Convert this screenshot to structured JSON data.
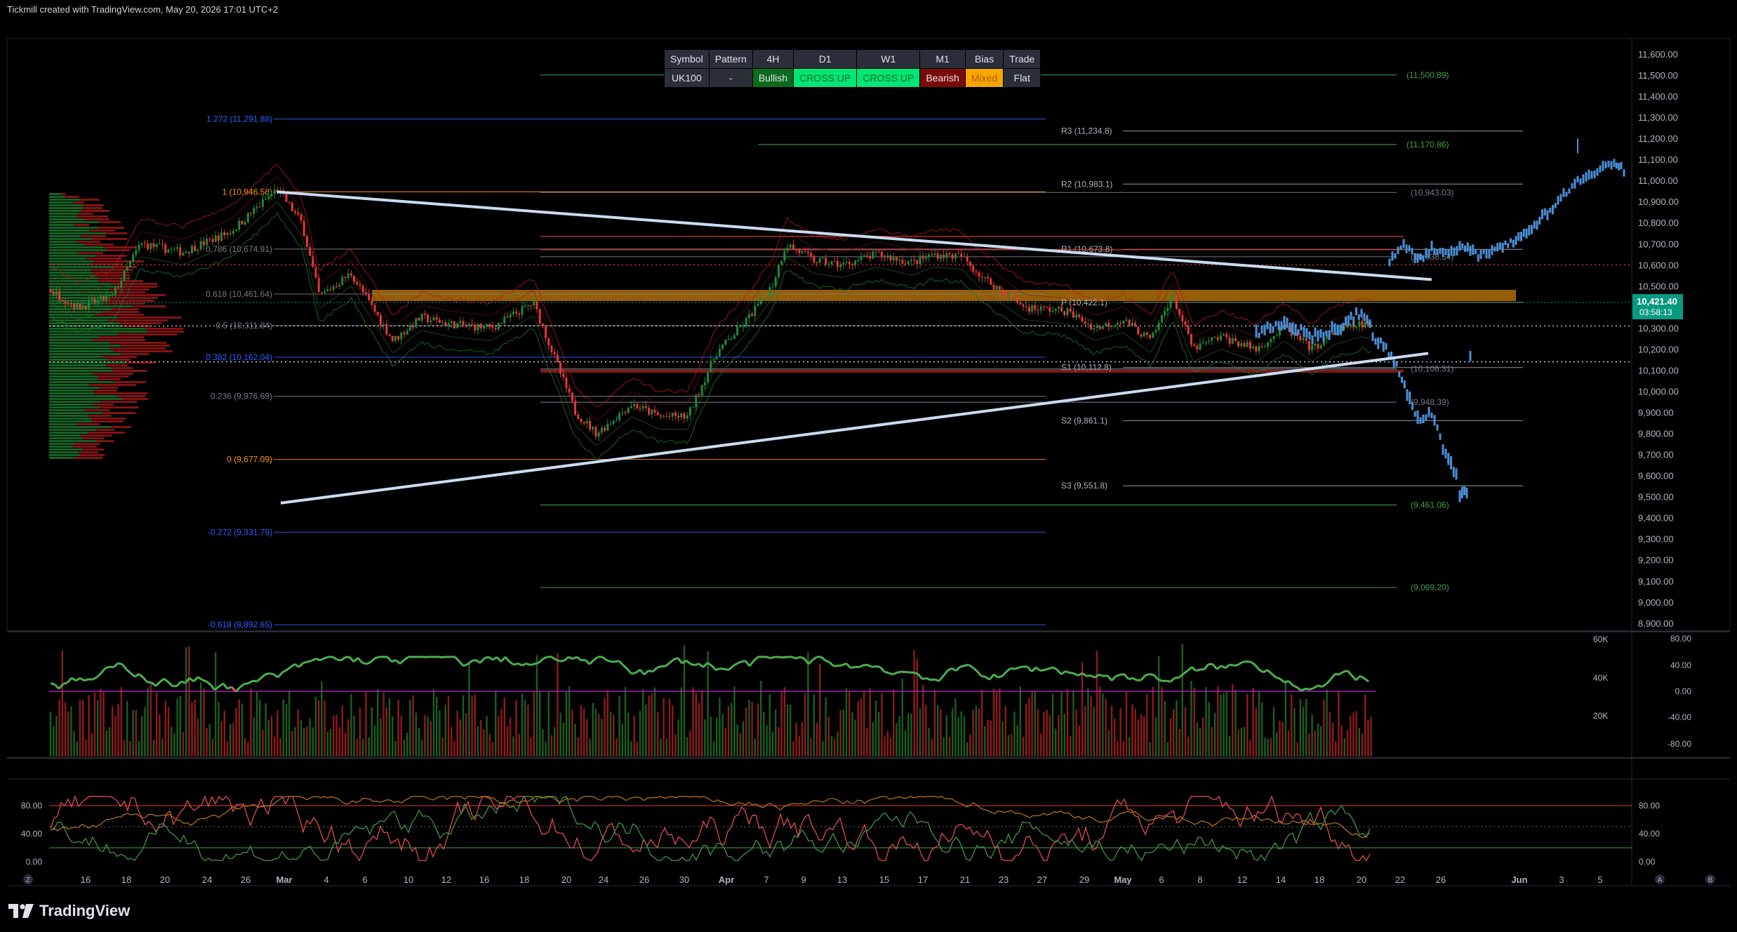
{
  "header": "Tickmill created with TradingView.com, May 20, 2026 17:01 UTC+2",
  "logo_text": "TradingView",
  "summary_table": {
    "headers": [
      "Symbol",
      "Pattern",
      "4H",
      "D1",
      "W1",
      "M1",
      "Bias",
      "Trade"
    ],
    "values": [
      {
        "text": "UK100",
        "bg": "#2a2e39",
        "fg": "#e0e3eb"
      },
      {
        "text": "-",
        "bg": "#2a2e39",
        "fg": "#e0e3eb"
      },
      {
        "text": "Bullish",
        "bg": "#0b6b1e",
        "fg": "#e0e3eb"
      },
      {
        "text": "CROSS UP",
        "bg": "#00e676",
        "fg": "#0b6b1e"
      },
      {
        "text": "CROSS UP",
        "bg": "#00e676",
        "fg": "#0b6b1e"
      },
      {
        "text": "Bearish",
        "bg": "#7a0a0a",
        "fg": "#e0e3eb"
      },
      {
        "text": "Mixed",
        "bg": "#f7a600",
        "fg": "#b85a00"
      },
      {
        "text": "Flat",
        "bg": "#2a2e39",
        "fg": "#e0e3eb"
      }
    ]
  },
  "colors": {
    "background": "#000000",
    "bull": "#26a69a",
    "candle_up": "#1f8a3a",
    "candle_down": "#e53935",
    "projection": "#4a90d9",
    "trendline": "#c8dcf0",
    "fib_blue": "#2962ff",
    "fib_orange": "#ff9800",
    "fib_grey": "#787b86",
    "green_level": "#2e7d32",
    "red_level": "#e53935",
    "price_tag": "#089981",
    "supply_zone": "#c77d0a"
  },
  "chart_data": {
    "type": "line",
    "symbol": "UK100",
    "timeframe": "4H",
    "current_price": "10,421.40",
    "countdown": "03:58:13",
    "ylim": [
      8900,
      11650
    ],
    "price_axis_labels": [
      "11,600.00",
      "11,500.00",
      "11,400.00",
      "11,300.00",
      "11,200.00",
      "11,100.00",
      "11,000.00",
      "10,900.00",
      "10,800.00",
      "10,700.00",
      "10,600.00",
      "10,500.00",
      "10,400.00",
      "10,300.00",
      "10,200.00",
      "10,100.00",
      "10,000.00",
      "9,900.00",
      "9,800.00",
      "9,700.00",
      "9,600.00",
      "9,500.00",
      "9,400.00",
      "9,300.00",
      "9,200.00",
      "9,100.00",
      "9,000.00",
      "8,900.00"
    ],
    "date_axis_labels": [
      "16",
      "18",
      "20",
      "24",
      "26",
      "Mar",
      "4",
      "6",
      "10",
      "12",
      "16",
      "18",
      "20",
      "24",
      "26",
      "30",
      "Apr",
      "7",
      "9",
      "13",
      "15",
      "17",
      "21",
      "23",
      "27",
      "29",
      "May",
      "6",
      "8",
      "12",
      "14",
      "18",
      "20",
      "22",
      "26",
      "Jun",
      "3",
      "5"
    ],
    "fib_levels": [
      {
        "label": "1.272 (11,291.88)",
        "price": 11291.88,
        "color": "#2962ff"
      },
      {
        "label": "1 (10,946.58)",
        "price": 10946.58,
        "color": "#ff9800"
      },
      {
        "label": "0.786 (10,674.91)",
        "price": 10674.91,
        "color": "#787b86"
      },
      {
        "label": "0.618 (10,461.64)",
        "price": 10461.64,
        "color": "#787b86"
      },
      {
        "label": "0.5 (10,311.84)",
        "price": 10311.84,
        "color": "#787b86"
      },
      {
        "label": "0.382 (10,162.04)",
        "price": 10162.04,
        "color": "#2962ff"
      },
      {
        "label": "0.236 (9,976.69)",
        "price": 9976.69,
        "color": "#787b86"
      },
      {
        "label": "0 (9,677.09)",
        "price": 9677.09,
        "color": "#ff9800"
      },
      {
        "label": "-0.272 (9,331.79)",
        "price": 9331.79,
        "color": "#2962ff"
      },
      {
        "label": "-0.618 (8,892.65)",
        "price": 8892.65,
        "color": "#2962ff"
      }
    ],
    "pivot_levels": [
      {
        "label": "R3 (11,234.8)",
        "price": 11234.8
      },
      {
        "label": "R2 (10,983.1)",
        "price": 10983.1
      },
      {
        "label": "R1 (10,673.8)",
        "price": 10673.8
      },
      {
        "label": "P (10,422.1)",
        "price": 10422.1
      },
      {
        "label": "S1 (10,112.8)",
        "price": 10112.8
      },
      {
        "label": "S2 (9,861.1)",
        "price": 9861.1
      },
      {
        "label": "S3 (9,551.8)",
        "price": 9551.8
      }
    ],
    "target_levels": [
      {
        "label": "(11,500.89)",
        "price": 11500.89,
        "color": "#43a047"
      },
      {
        "label": "(11,170.86)",
        "price": 11170.86,
        "color": "#43a047"
      },
      {
        "label": "(10,943.03)",
        "price": 10943.03,
        "color": "#787b86"
      },
      {
        "label": "(10,638.54)",
        "price": 10638.54,
        "color": "#787b86"
      },
      {
        "label": "(10,106.31)",
        "price": 10106.31,
        "color": "#787b86"
      },
      {
        "label": "(9,948.39)",
        "price": 9948.39,
        "color": "#787b86"
      },
      {
        "label": "(9,461.06)",
        "price": 9461.06,
        "color": "#43a047"
      },
      {
        "label": "(9,069.20)",
        "price": 9069.2,
        "color": "#43a047"
      }
    ],
    "volume_axis_labels": [
      "60K",
      "40K",
      "20K"
    ],
    "oscillator_axis_labels": [
      "80.00",
      "40.00",
      "0.00",
      "-40.00",
      "-80.00"
    ],
    "stoch_axis_labels": [
      "80.00",
      "40.00",
      "0.00"
    ]
  }
}
